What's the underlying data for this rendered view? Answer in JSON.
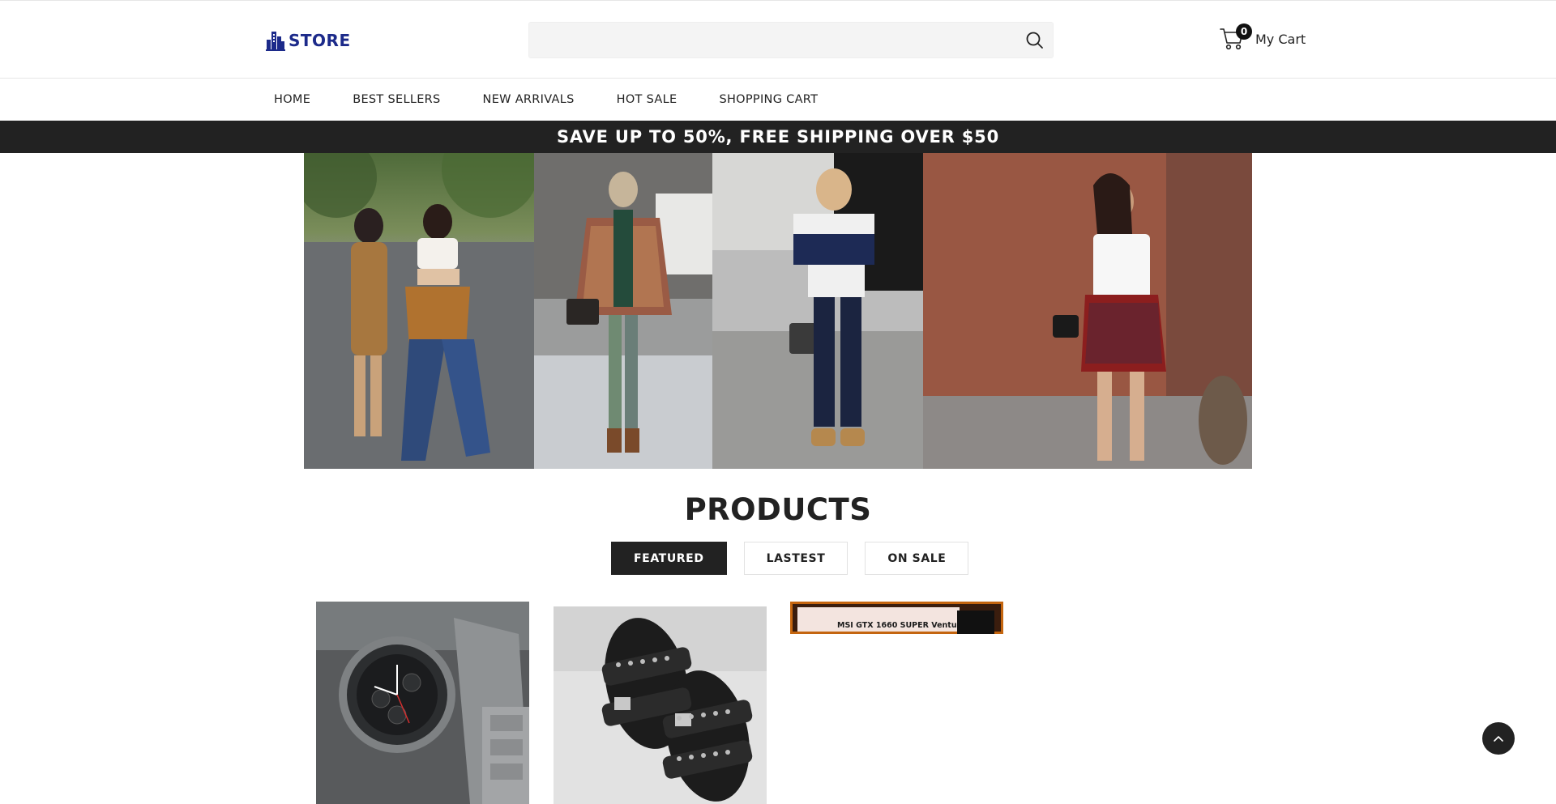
{
  "header": {
    "logo_text": "STORE",
    "search": {
      "value": "",
      "placeholder": ""
    },
    "cart": {
      "count": "0",
      "label": "My Cart"
    }
  },
  "nav": {
    "items": [
      {
        "label": "HOME"
      },
      {
        "label": "BEST SELLERS"
      },
      {
        "label": "NEW ARRIVALS"
      },
      {
        "label": "HOT SALE"
      },
      {
        "label": "SHOPPING CART"
      }
    ]
  },
  "promo": {
    "text": "SAVE UP TO 50%, FREE SHIPPING OVER $50"
  },
  "hero": {
    "panels": [
      {
        "name": "street-style-photo-1"
      },
      {
        "name": "street-style-photo-2"
      },
      {
        "name": "street-style-photo-3"
      },
      {
        "name": "street-style-photo-4"
      }
    ]
  },
  "products": {
    "title": "PRODUCTS",
    "tabs": [
      {
        "label": "FEATURED",
        "active": true
      },
      {
        "label": "LASTEST",
        "active": false
      },
      {
        "label": "ON SALE",
        "active": false
      }
    ],
    "items": [
      {
        "name": "smartwatch-product-image"
      },
      {
        "name": "sandals-product-image"
      },
      {
        "name": "gpu-product-image",
        "caption": "MSI GTX 1660 SUPER Ventus"
      }
    ]
  },
  "colors": {
    "accent": "#222222",
    "brand": "#1c2a8a",
    "background": "#ffffff"
  },
  "icons": [
    "store-building-icon",
    "search-icon",
    "cart-icon",
    "chevron-up-icon"
  ]
}
